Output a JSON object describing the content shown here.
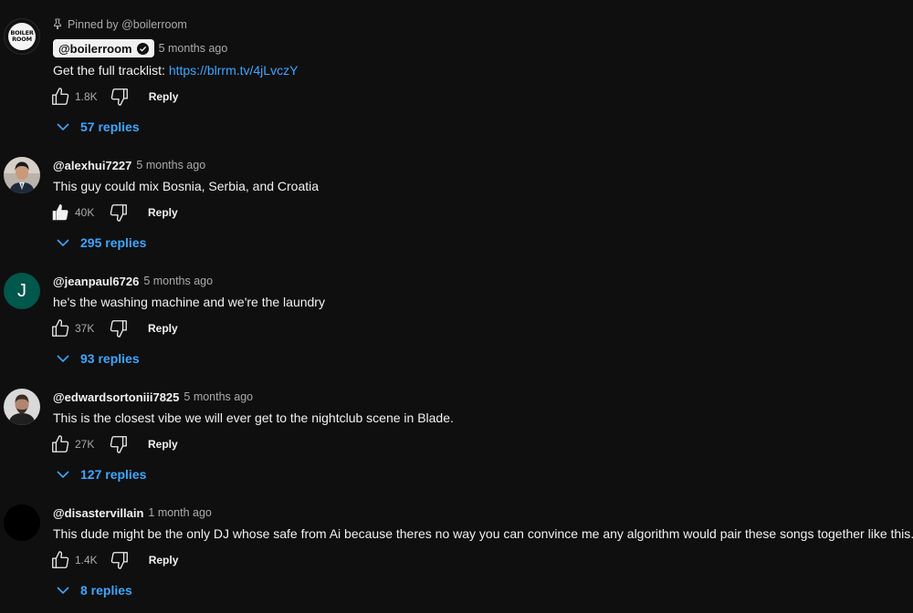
{
  "pinned_label": "Pinned by @boilerroom",
  "colors": {
    "background": "#0f0f0f",
    "text": "#f1f1f1",
    "muted": "#aaaaaa",
    "link": "#3ea6ff",
    "avatar_letter_bg": "#00574b"
  },
  "comments": [
    {
      "author": "@boilerroom",
      "verified": true,
      "avatar": {
        "type": "logo",
        "logo_text": "BOILER ROOM"
      },
      "time": "5 months ago",
      "text_prefix": "Get the full tracklist: ",
      "link": "https://blrrm.tv/4jLvczY",
      "likes": "1.8K",
      "liked": false,
      "reply_label": "Reply",
      "replies": "57 replies"
    },
    {
      "author": "@alexhui7227",
      "avatar": {
        "type": "photo",
        "icon": "person-photo-icon"
      },
      "time": "5 months ago",
      "text": "This guy could mix Bosnia, Serbia, and Croatia",
      "likes": "40K",
      "liked": true,
      "reply_label": "Reply",
      "replies": "295 replies"
    },
    {
      "author": "@jeanpaul6726",
      "avatar": {
        "type": "letter",
        "letter": "J"
      },
      "time": "5 months ago",
      "text": "he's the washing machine and we're the laundry",
      "likes": "37K",
      "liked": false,
      "reply_label": "Reply",
      "replies": "93 replies"
    },
    {
      "author": "@edwardsortoniii7825",
      "avatar": {
        "type": "photo",
        "icon": "person-photo-icon"
      },
      "time": "5 months ago",
      "text": "This is the closest vibe we will ever get to the nightclub scene in Blade.",
      "likes": "27K",
      "liked": false,
      "reply_label": "Reply",
      "replies": "127 replies"
    },
    {
      "author": "@disastervillain",
      "avatar": {
        "type": "blank"
      },
      "time": "1 month ago",
      "text": "This dude might be the only DJ whose safe from Ai because theres no way you can convince me any algorithm would pair these songs together like this.",
      "likes": "1.4K",
      "liked": false,
      "reply_label": "Reply",
      "replies": "8 replies"
    }
  ]
}
